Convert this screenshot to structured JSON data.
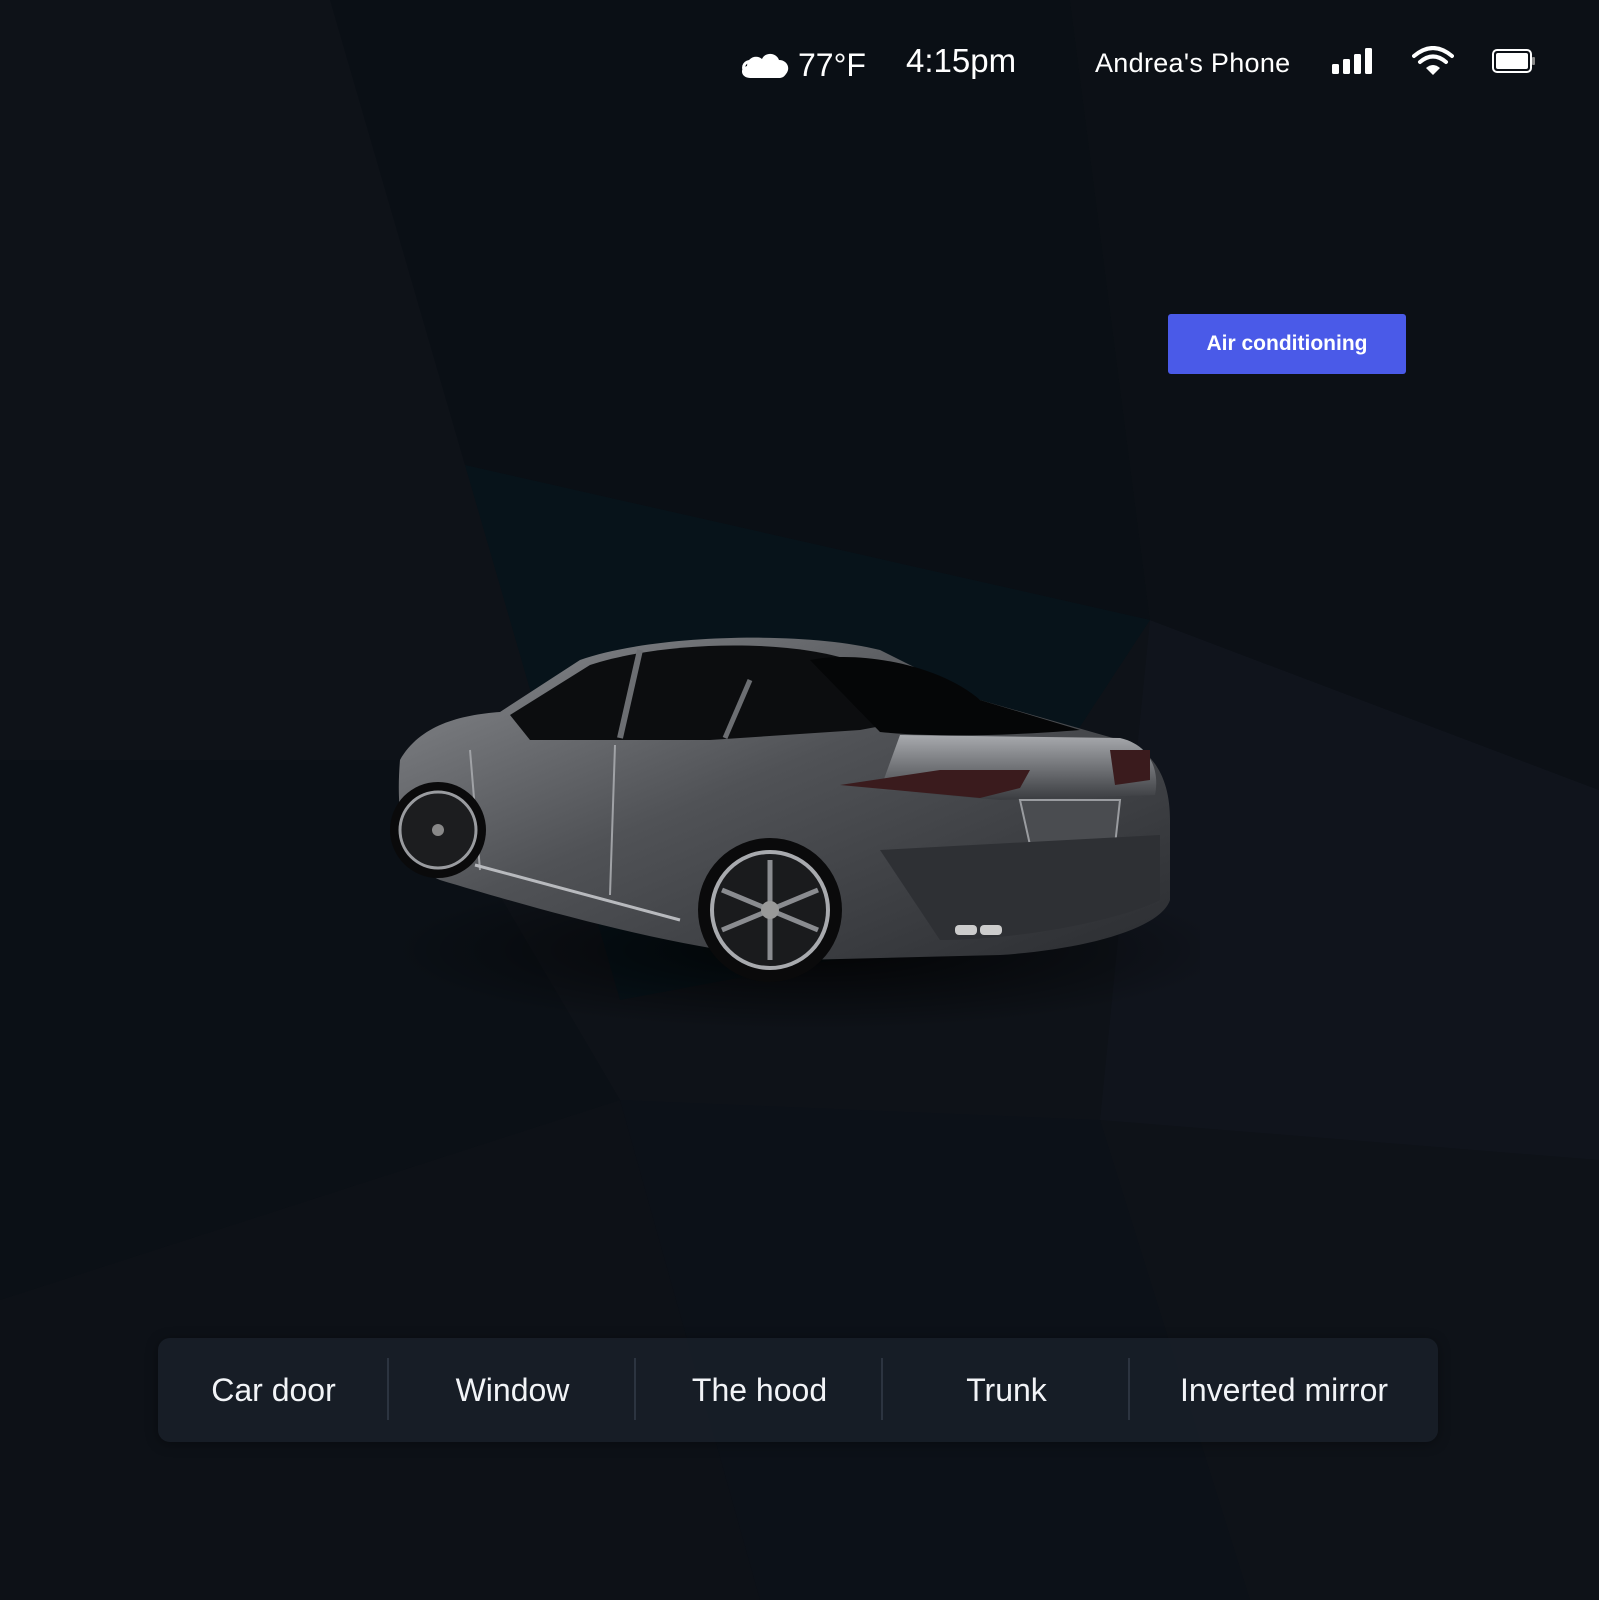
{
  "status_bar": {
    "weather_icon": "cloud-icon",
    "temperature": "77°F",
    "time": "4:15pm",
    "connected_device": "Andrea's Phone",
    "signal_icon": "signal-bars-icon",
    "wifi_icon": "wifi-icon",
    "battery_icon": "battery-icon"
  },
  "actions": {
    "air_conditioning": "Air conditioning"
  },
  "vehicle": {
    "image": "car-rear-three-quarter-view"
  },
  "controls": [
    {
      "label": "Car door"
    },
    {
      "label": "Window"
    },
    {
      "label": "The hood"
    },
    {
      "label": "Trunk"
    },
    {
      "label": "Inverted mirror"
    }
  ],
  "colors": {
    "background": "#0d1117",
    "accent": "#4a5ae8",
    "control_bar": "#181e28",
    "text": "#ffffff"
  }
}
